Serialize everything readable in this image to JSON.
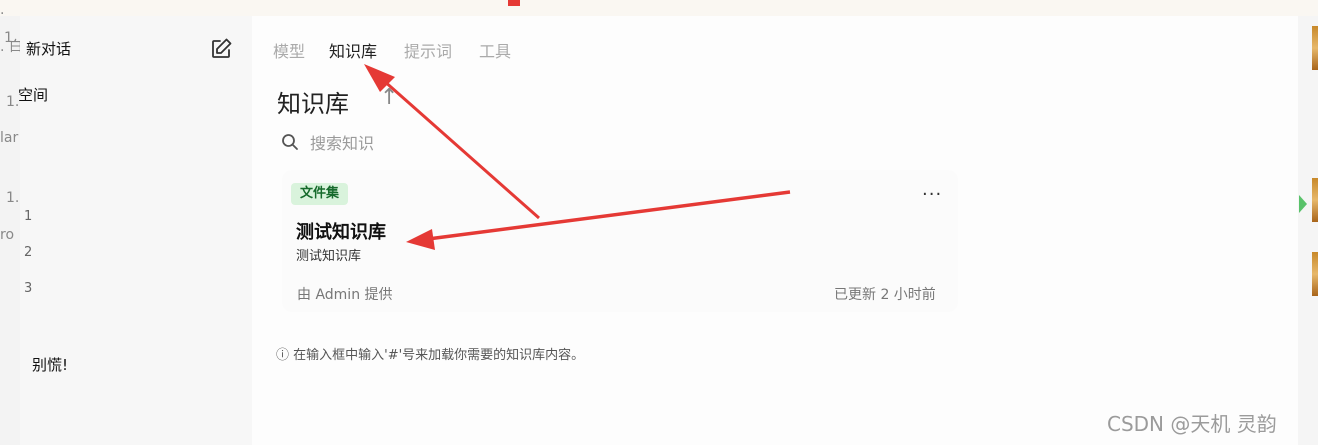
{
  "background": {
    "left_fragments": [
      ". ",
      "1.",
      ". 白",
      "1.",
      "lar",
      "1.",
      "ro"
    ]
  },
  "sidebar": {
    "new_chat_label": "新对话",
    "space_label": "空间",
    "numbers": [
      "1",
      "2",
      "3"
    ],
    "bottom_text": "别慌!"
  },
  "tabs": [
    {
      "label": "模型",
      "active": false
    },
    {
      "label": "知识库",
      "active": true
    },
    {
      "label": "提示词",
      "active": false
    },
    {
      "label": "工具",
      "active": false
    }
  ],
  "main": {
    "title": "知识库",
    "title_action": "↑",
    "search": {
      "placeholder": "搜索知识",
      "value": ""
    },
    "card": {
      "type_badge": "文件集",
      "menu": "···",
      "name": "测试知识库",
      "description": "测试知识库",
      "provider": "由 Admin 提供",
      "updated": "已更新 2 小时前"
    },
    "hint": "ⓘ 在输入框中输入'#'号来加载你需要的知识库内容。"
  },
  "watermark": "CSDN @天机 灵韵",
  "colors": {
    "annotation_arrow": "#e53935",
    "badge_bg": "#d9f3dc",
    "badge_text": "#166b2c"
  }
}
